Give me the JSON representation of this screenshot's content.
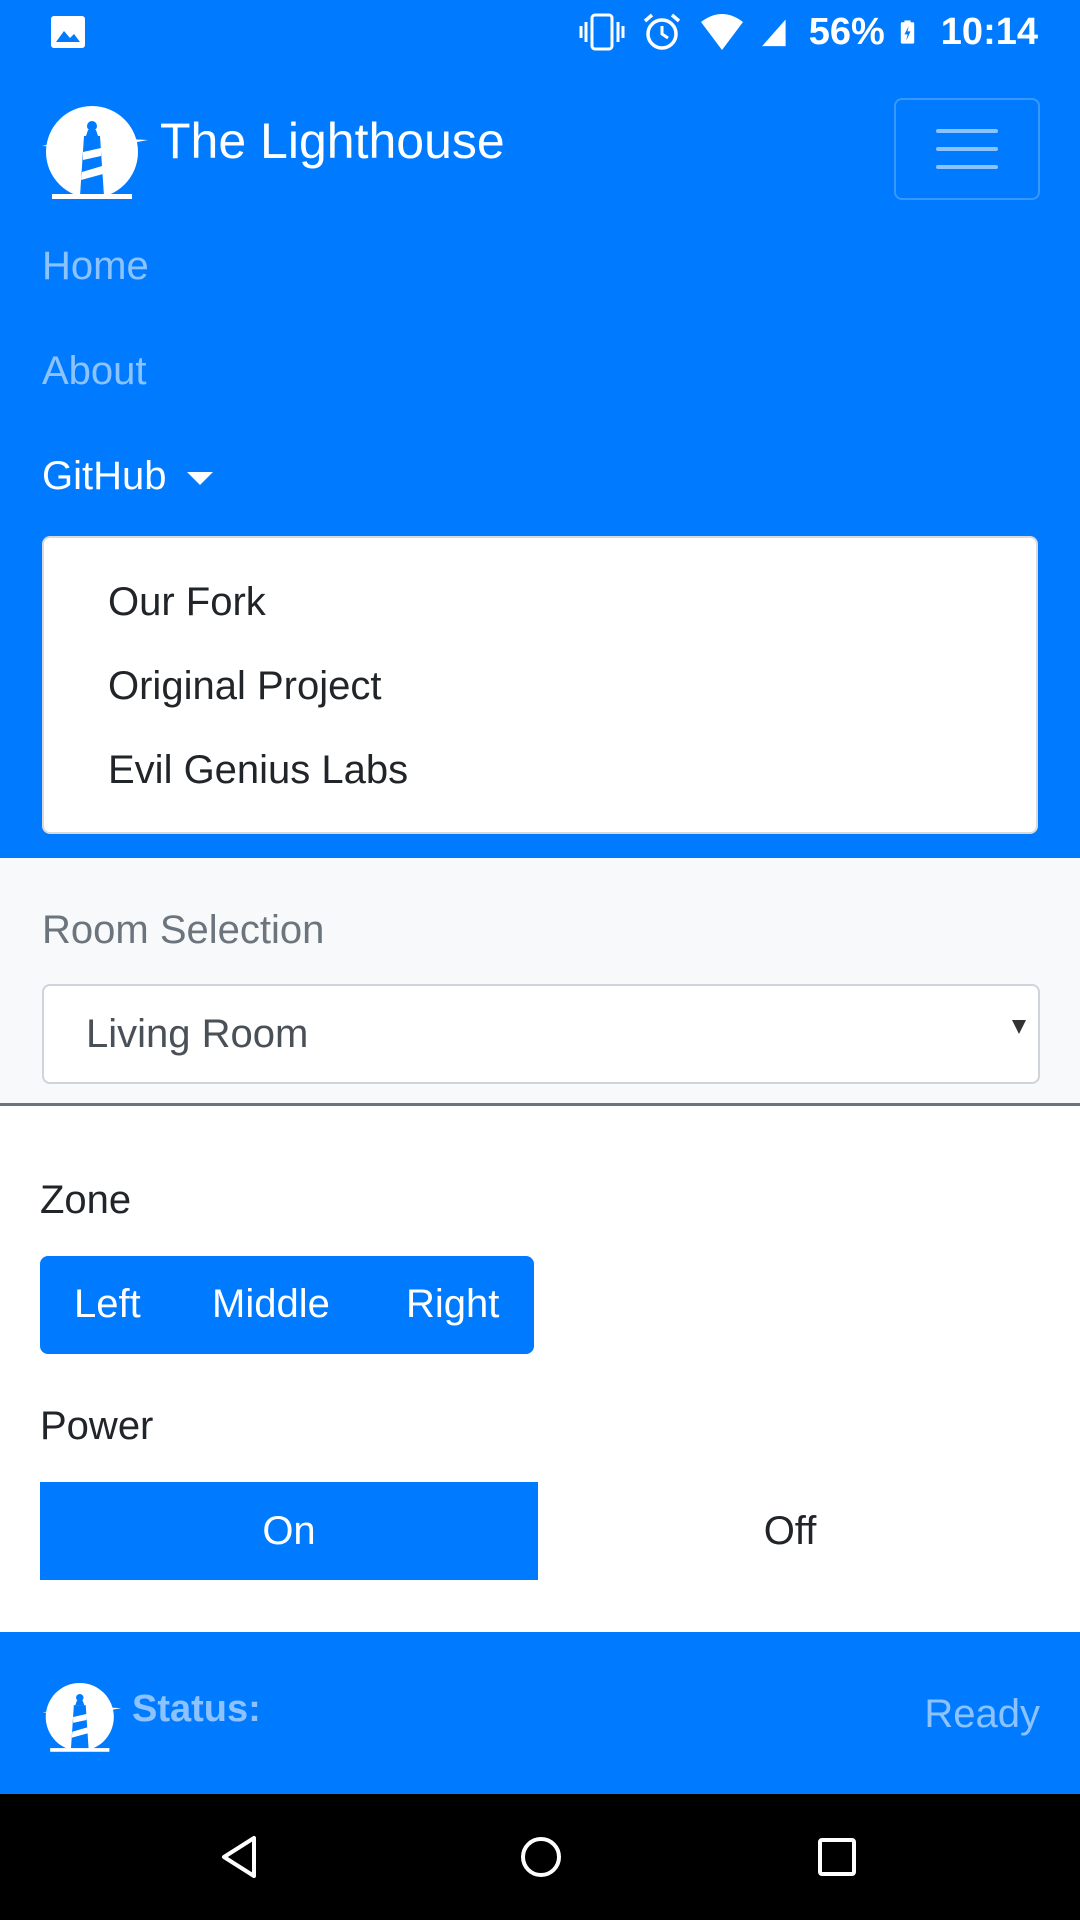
{
  "status_bar": {
    "battery": "56%",
    "time": "10:14",
    "icons": [
      "gallery-icon",
      "vibrate-icon",
      "alarm-icon",
      "wifi-icon",
      "signal-icon",
      "battery-charging-icon"
    ]
  },
  "navbar": {
    "brand": "The Lighthouse",
    "links": {
      "home": "Home",
      "about": "About",
      "github": "GitHub"
    },
    "dropdown": [
      "Our Fork",
      "Original Project",
      "Evil Genius Labs"
    ]
  },
  "room": {
    "label": "Room Selection",
    "selected": "Living Room"
  },
  "zone": {
    "label": "Zone",
    "options": [
      "Left",
      "Middle",
      "Right"
    ]
  },
  "power": {
    "label": "Power",
    "on": "On",
    "off": "Off"
  },
  "footer": {
    "status_label": "Status:",
    "status_value": "Ready"
  },
  "colors": {
    "primary": "#007bff",
    "light_bg": "#f8f9fa",
    "muted": "#6c757d",
    "text": "#212529"
  }
}
